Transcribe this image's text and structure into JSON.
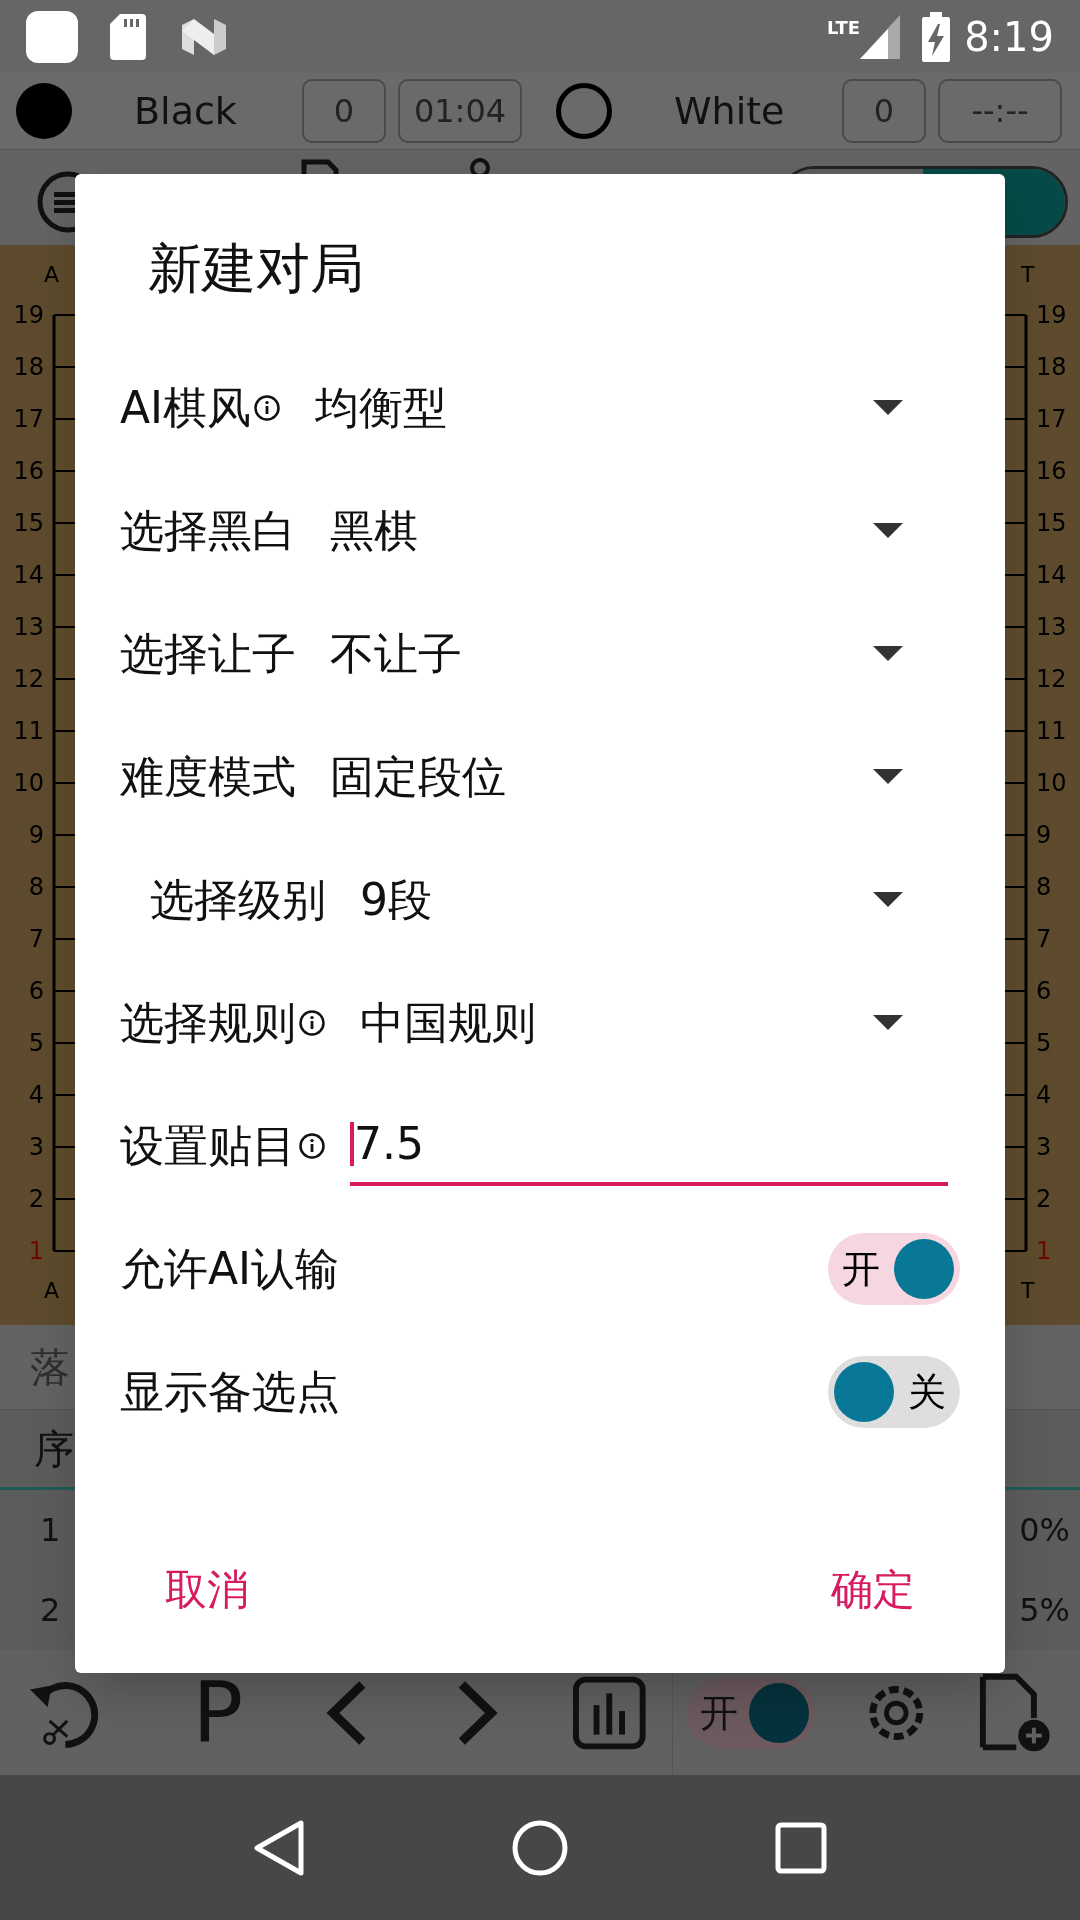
{
  "status_bar": {
    "network": "LTE",
    "time": "8:19"
  },
  "players": [
    {
      "kind": "filled",
      "name": "Black",
      "captures": "0",
      "clock": "01:04"
    },
    {
      "kind": "hollow",
      "name": "White",
      "captures": "0",
      "clock": "--:--"
    }
  ],
  "board": {
    "left_edge": {
      "top": "A",
      "bottom": "A",
      "rows": [
        {
          "text": "19",
          "highlighted": false
        },
        {
          "text": "18",
          "highlighted": false
        },
        {
          "text": "17",
          "highlighted": false
        },
        {
          "text": "16",
          "highlighted": false
        },
        {
          "text": "15",
          "highlighted": false
        },
        {
          "text": "14",
          "highlighted": false
        },
        {
          "text": "13",
          "highlighted": false
        },
        {
          "text": "12",
          "highlighted": false
        },
        {
          "text": "11",
          "highlighted": false
        },
        {
          "text": "10",
          "highlighted": false
        },
        {
          "text": "9",
          "highlighted": false
        },
        {
          "text": "8",
          "highlighted": false
        },
        {
          "text": "7",
          "highlighted": false
        },
        {
          "text": "6",
          "highlighted": false
        },
        {
          "text": "5",
          "highlighted": false
        },
        {
          "text": "4",
          "highlighted": false
        },
        {
          "text": "3",
          "highlighted": false
        },
        {
          "text": "2",
          "highlighted": false
        },
        {
          "text": "1",
          "highlighted": true
        }
      ]
    },
    "right_edge": {
      "top": "T",
      "bottom": "T",
      "rows": [
        {
          "text": "19",
          "highlighted": false
        },
        {
          "text": "18",
          "highlighted": false
        },
        {
          "text": "17",
          "highlighted": false
        },
        {
          "text": "16",
          "highlighted": false
        },
        {
          "text": "15",
          "highlighted": false
        },
        {
          "text": "14",
          "highlighted": false
        },
        {
          "text": "13",
          "highlighted": false
        },
        {
          "text": "12",
          "highlighted": false
        },
        {
          "text": "11",
          "highlighted": false
        },
        {
          "text": "10",
          "highlighted": false
        },
        {
          "text": "9",
          "highlighted": false
        },
        {
          "text": "8",
          "highlighted": false
        },
        {
          "text": "7",
          "highlighted": false
        },
        {
          "text": "6",
          "highlighted": false
        },
        {
          "text": "5",
          "highlighted": false
        },
        {
          "text": "4",
          "highlighted": false
        },
        {
          "text": "3",
          "highlighted": false
        },
        {
          "text": "2",
          "highlighted": false
        },
        {
          "text": "1",
          "highlighted": true
        }
      ]
    }
  },
  "move_panel": {
    "title": "落",
    "header": "序",
    "rows": [
      {
        "column_1": "1",
        "column_2": "0%"
      },
      {
        "column_1": "2",
        "column_2": "5%"
      }
    ]
  },
  "bottom_toolbar": {
    "pass_label": "P",
    "toggle": {
      "label": "开",
      "on": true
    }
  },
  "dialog": {
    "title": "新建对局",
    "rows": [
      {
        "kind": "dropdown",
        "label": "AI棋风",
        "info": true,
        "indented": false,
        "value": "均衡型"
      },
      {
        "kind": "dropdown",
        "label": "选择黑白",
        "info": false,
        "indented": false,
        "value": "黑棋"
      },
      {
        "kind": "dropdown",
        "label": "选择让子",
        "info": false,
        "indented": false,
        "value": "不让子"
      },
      {
        "kind": "dropdown",
        "label": "难度模式",
        "info": false,
        "indented": false,
        "value": "固定段位"
      },
      {
        "kind": "dropdown",
        "label": "选择级别",
        "info": false,
        "indented": true,
        "value": "9段"
      },
      {
        "kind": "dropdown",
        "label": "选择规则",
        "info": true,
        "indented": false,
        "value": "中国规则"
      },
      {
        "kind": "input",
        "label": "设置贴目",
        "info": true,
        "indented": false,
        "value": "7.5",
        "focused": true
      },
      {
        "kind": "switch",
        "label": "允许AI认输",
        "info": false,
        "indented": false,
        "on": true,
        "state_text": "开"
      },
      {
        "kind": "switch",
        "label": "显示备选点",
        "info": false,
        "indented": false,
        "on": false,
        "state_text": "关"
      }
    ],
    "buttons": [
      "取消",
      "确定"
    ]
  }
}
